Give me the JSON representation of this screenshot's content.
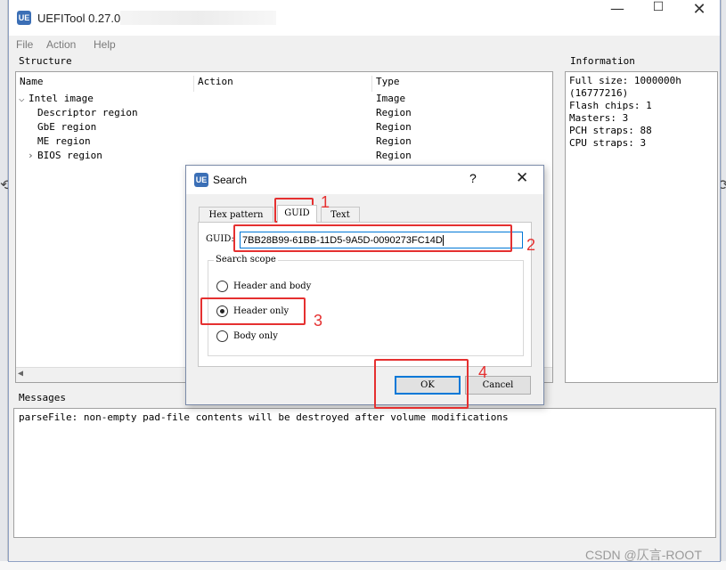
{
  "window": {
    "title": "UEFITool 0.27.0",
    "menu": [
      "File",
      "Action",
      "Help"
    ]
  },
  "structure": {
    "group_title": "Structure",
    "columns": [
      "Name",
      "Action",
      "Type"
    ],
    "rows": [
      {
        "name": "Intel image",
        "type": "Image",
        "expander": "expanded"
      },
      {
        "name": "Descriptor region",
        "type": "Region",
        "expander": ""
      },
      {
        "name": "GbE region",
        "type": "Region",
        "expander": ""
      },
      {
        "name": "ME region",
        "type": "Region",
        "expander": ""
      },
      {
        "name": "BIOS region",
        "type": "Region",
        "expander": "collapsed"
      }
    ]
  },
  "information": {
    "group_title": "Information",
    "lines": [
      "Full size: 1000000h",
      "(16777216)",
      "Flash chips: 1",
      "Masters: 3",
      "PCH straps: 88",
      "CPU straps: 3"
    ]
  },
  "messages": {
    "group_title": "Messages",
    "lines": [
      "parseFile: non-empty pad-file contents will be destroyed after volume modifications"
    ]
  },
  "search_dialog": {
    "title": "Search",
    "help": "?",
    "tabs": [
      "Hex pattern",
      "GUID",
      "Text"
    ],
    "active_tab": "GUID",
    "guid_label": "GUID:",
    "guid_value": "7BB28B99-61BB-11D5-9A5D-0090273FC14D",
    "scope_title": "Search scope",
    "scope_options": [
      "Header and body",
      "Header only",
      "Body only"
    ],
    "selected_scope": "Header only",
    "ok_label": "OK",
    "cancel_label": "Cancel"
  },
  "annotations": [
    "1",
    "2",
    "3",
    "4"
  ],
  "watermark": "CSDN @仄言-ROOT",
  "colors": {
    "annotation": "#e53030",
    "focus": "#0078d7",
    "window_bg": "#f0f0f0"
  }
}
